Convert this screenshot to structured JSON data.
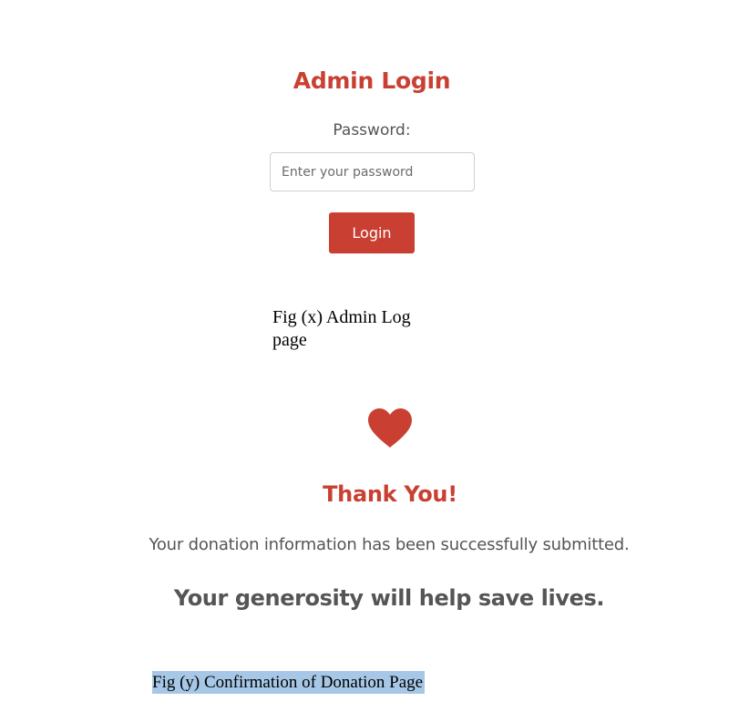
{
  "login": {
    "title": "Admin Login",
    "password_label": "Password:",
    "password_placeholder": "Enter your password",
    "password_value": "",
    "login_button": "Login"
  },
  "caption_x": "Fig (x) Admin Log page",
  "confirmation": {
    "icon": "heart-icon",
    "title": "Thank You!",
    "message": "Your donation information has been successfully submitted.",
    "generosity": "Your generosity will help save lives."
  },
  "caption_y": "Fig (y) Confirmation of Donation Page",
  "colors": {
    "accent": "#c94033",
    "text_muted": "#555555",
    "highlight": "#a6c8e6"
  }
}
